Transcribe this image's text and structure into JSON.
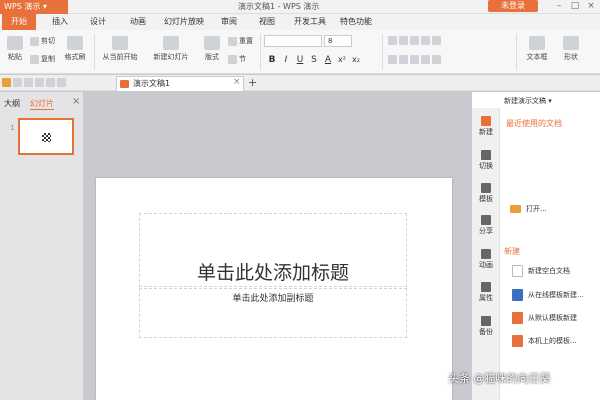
{
  "app": {
    "name": "WPS 演示",
    "doc_title": "演示文稿1 - WPS 演示",
    "login": "未登录"
  },
  "menu_tabs": [
    "开始",
    "插入",
    "设计",
    "动画",
    "幻灯片放映",
    "审阅",
    "视图",
    "开发工具",
    "特色功能"
  ],
  "ribbon": {
    "paste": "粘贴",
    "cut": "剪切",
    "copy": "复制",
    "format_painter": "格式刷",
    "from_current": "从当前开始",
    "new_slide": "新建幻灯片",
    "layout": "版式",
    "section": "节",
    "reset": "重置",
    "font_size": "8",
    "textbox": "文本框",
    "shape": "形状"
  },
  "doc_tab": {
    "label": "演示文稿1",
    "add": "+"
  },
  "left_panel": {
    "tab_outline": "大纲",
    "tab_slides": "幻灯片",
    "close": "×",
    "slide_number": "1"
  },
  "slide": {
    "title_placeholder": "单击此处添加标题",
    "subtitle_placeholder": "单击此处添加副标题"
  },
  "task_pane": {
    "header": "新建演示文稿",
    "recent_title": "最近使用的文档",
    "open": "打开...",
    "new_title": "新建",
    "items": [
      "新建空白文档",
      "从在线模板新建...",
      "从默认模板新建",
      "本机上的模板..."
    ],
    "side_tabs": [
      "新建",
      "切换",
      "模板",
      "分享",
      "动画",
      "属性",
      "备份"
    ]
  },
  "watermark": "头条 @猫咪的向日葵",
  "colors": {
    "accent": "#e8703a",
    "panel": "#e4e4e6",
    "workspace": "#c8cacf"
  }
}
